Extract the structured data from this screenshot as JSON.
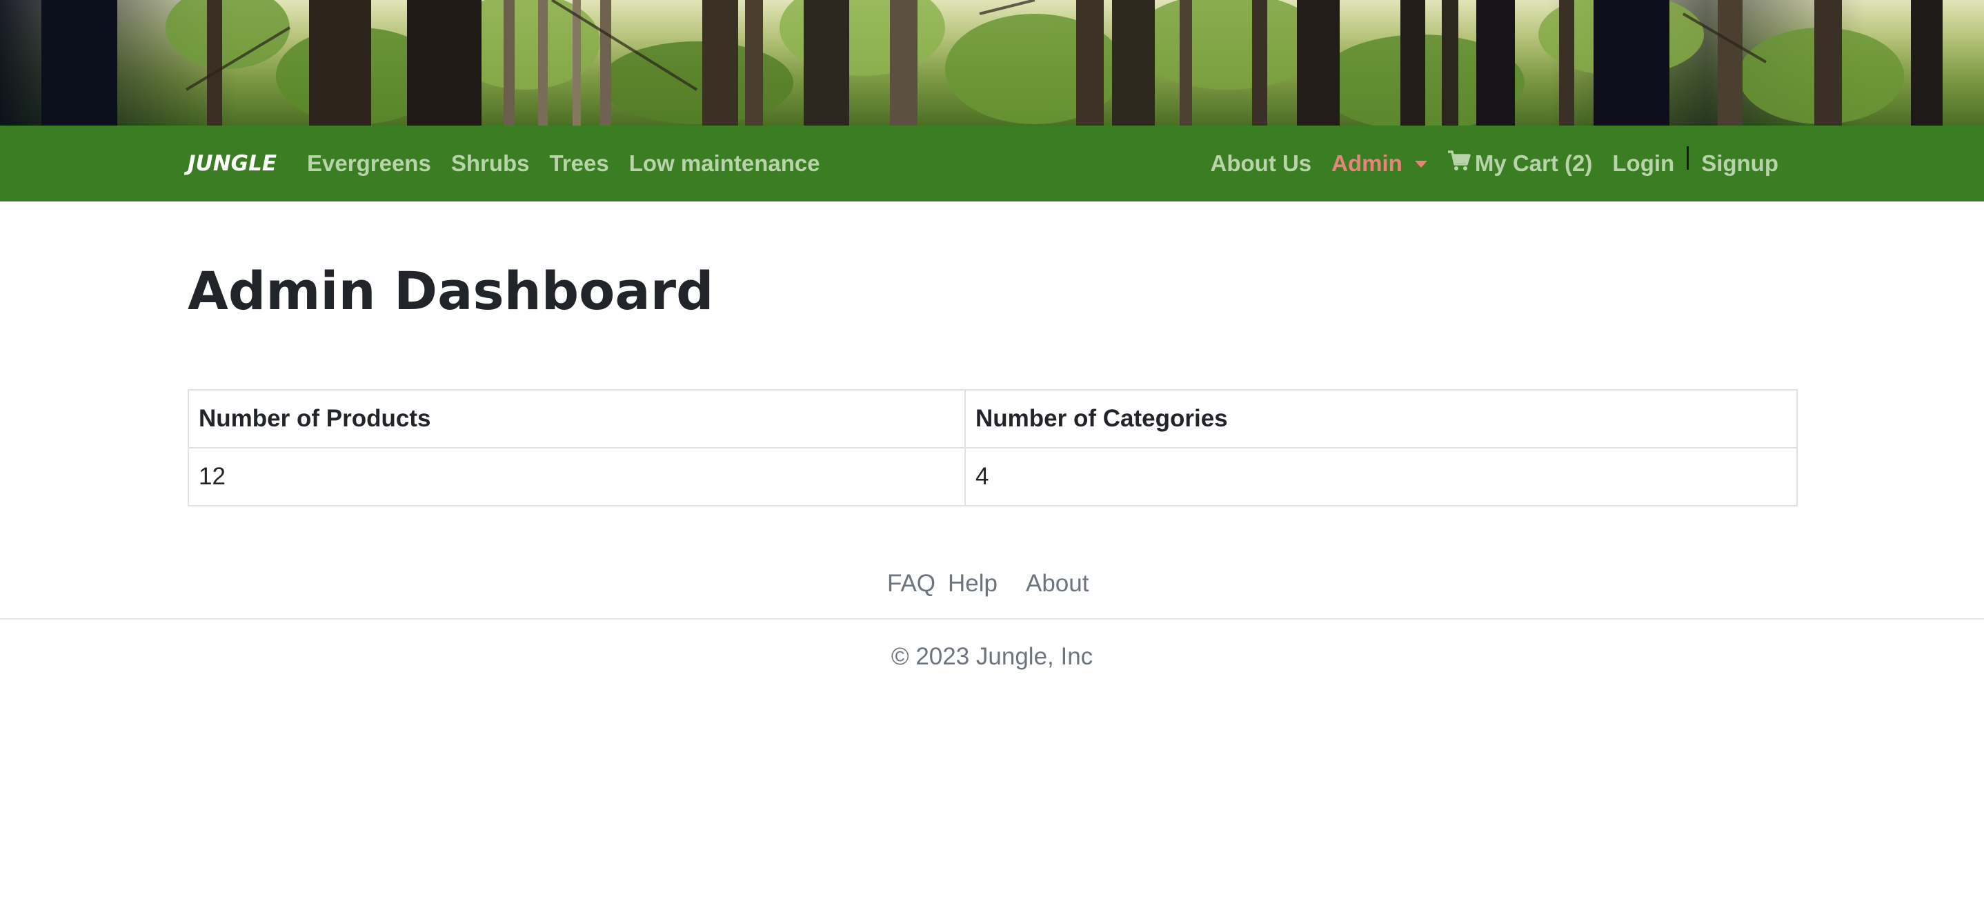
{
  "nav": {
    "brand": "JUNGLE",
    "left_links": [
      "Evergreens",
      "Shrubs",
      "Trees",
      "Low maintenance"
    ],
    "about": "About Us",
    "admin": "Admin",
    "cart": "My Cart (2)",
    "login": "Login",
    "signup": "Signup"
  },
  "main": {
    "title": "Admin Dashboard",
    "table": {
      "headers": [
        "Number of Products",
        "Number of Categories"
      ],
      "values": [
        "12",
        "4"
      ]
    }
  },
  "footer": {
    "links": [
      "FAQ",
      "Help",
      "About"
    ],
    "copyright": "© 2023 Jungle, Inc"
  },
  "colors": {
    "navbar": "#3a7d22",
    "nav_link": "#b9d3aa",
    "admin_link": "#e8837c",
    "text": "#212529",
    "muted": "#6c757d"
  },
  "icons": {
    "cart": "cart-icon",
    "admin_dropdown": "caret-down-icon"
  }
}
